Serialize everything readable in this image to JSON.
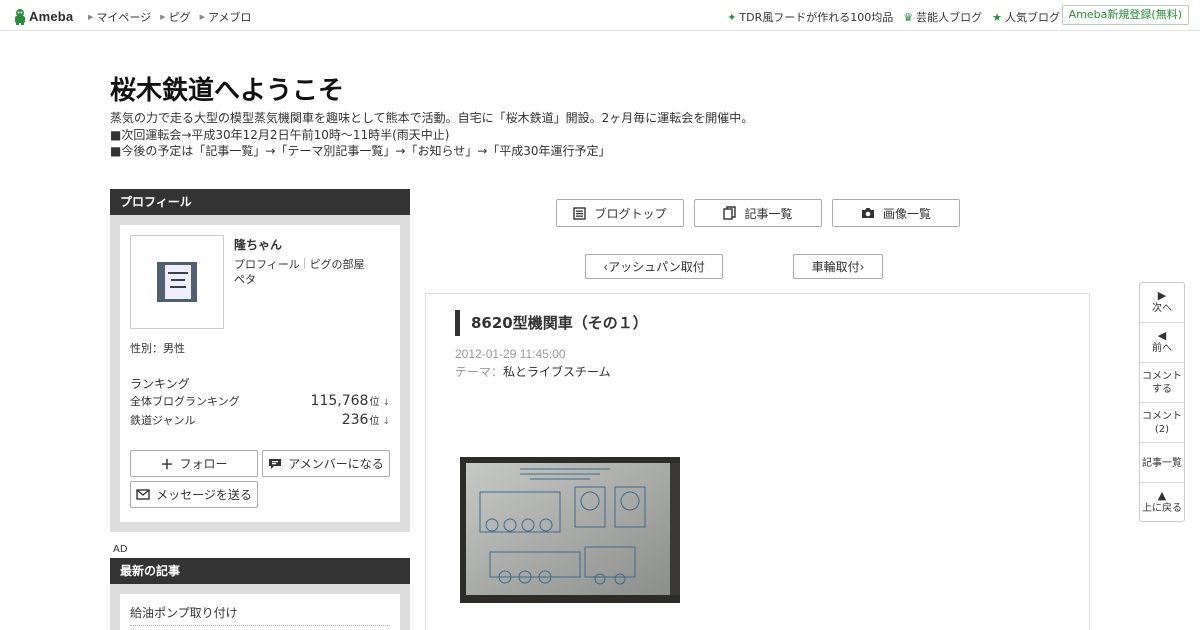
{
  "topbar": {
    "logo_text": "Ameba",
    "nav": [
      "マイページ",
      "ピグ",
      "アメブロ"
    ],
    "right_links": [
      "TDR風フードが作れる100均品",
      "芸能人ブログ",
      "人気ブログ"
    ],
    "signup_label": "Ameba新規登録(無料)"
  },
  "header": {
    "title": "桜木鉄道へようこそ",
    "description": [
      "蒸気の力で走る大型の模型蒸気機関車を趣味として熊本で活動。自宅に「桜木鉄道」開設。2ヶ月毎に運転会を開催中。",
      "■次回運転会→平成30年12月2日午前10時～11時半(雨天中止)",
      "■今後の予定は「記事一覧」→「テーマ別記事一覧」→「お知らせ」→「平成30年運行予定」"
    ]
  },
  "profile": {
    "heading": "プロフィール",
    "name": "隆ちゃん",
    "link_profile": "プロフィール",
    "link_pig": "ピグの部屋",
    "peta": "ペタ",
    "gender": "性別：男性",
    "ranking_title": "ランキング",
    "rankings": [
      {
        "label": "全体ブログランキング",
        "value": "115,768",
        "unit": "位",
        "arrow": "↓"
      },
      {
        "label": "鉄道ジャンル",
        "value": "236",
        "unit": "位",
        "arrow": "↓"
      }
    ],
    "follow_label": "フォロー",
    "amember_label": "アメンバーになる",
    "message_label": "メッセージを送る"
  },
  "ad_label": "AD",
  "recent": {
    "heading": "最新の記事",
    "items": [
      "給油ポンプ取り付け"
    ]
  },
  "main_nav": {
    "blog_top": "ブログトップ",
    "article_list": "記事一覧",
    "image_list": "画像一覧"
  },
  "pager": {
    "prev_label": "アッシュパン取付",
    "next_label": "車輪取付"
  },
  "article": {
    "title": "8620型機関車（その１）",
    "date": "2012-01-29 11:45:00",
    "theme_label": "テーマ：",
    "theme": "私とライブスチーム"
  },
  "sidenav": {
    "next": "次へ",
    "prev": "前へ",
    "comment_do_1": "コメント",
    "comment_do_2": "する",
    "comments_1": "コメント",
    "comments_2": "(2)",
    "article_list": "記事一覧",
    "to_top": "上に戻る"
  },
  "colors": {
    "ameba_green": "#2d8c3c",
    "heading_bg": "#333333",
    "sidebar_frame": "#dddddd"
  }
}
